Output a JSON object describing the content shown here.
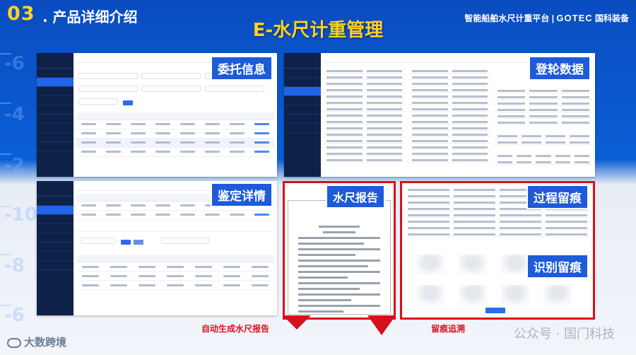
{
  "header": {
    "section_number": "03",
    "section_title": ". 产品详细介绍",
    "main_title": "E-水尺计重管理",
    "brand_platform": "智能船舶水尺计重平台",
    "brand_separator": "|",
    "brand_logo": "GOTEC",
    "brand_name": "国科装备"
  },
  "ruler": [
    "-6",
    "-4",
    "-2",
    "-10",
    "-8",
    "-6"
  ],
  "tags": {
    "commission": "委托信息",
    "boarding": "登轮数据",
    "appraisal": "鉴定详情",
    "draft_report": "水尺报告",
    "process_trace": "过程留痕",
    "recognition_trace": "识别留痕"
  },
  "captions": {
    "auto_report": "自动生成水尺报告",
    "trace": "留痕追溯"
  },
  "footer": {
    "logo": "大数跨境",
    "watermark": "公众号 · 国门科技"
  },
  "colors": {
    "accent": "#ffd21f",
    "highlight": "#d8101b",
    "tag": "#1d5bd8"
  }
}
